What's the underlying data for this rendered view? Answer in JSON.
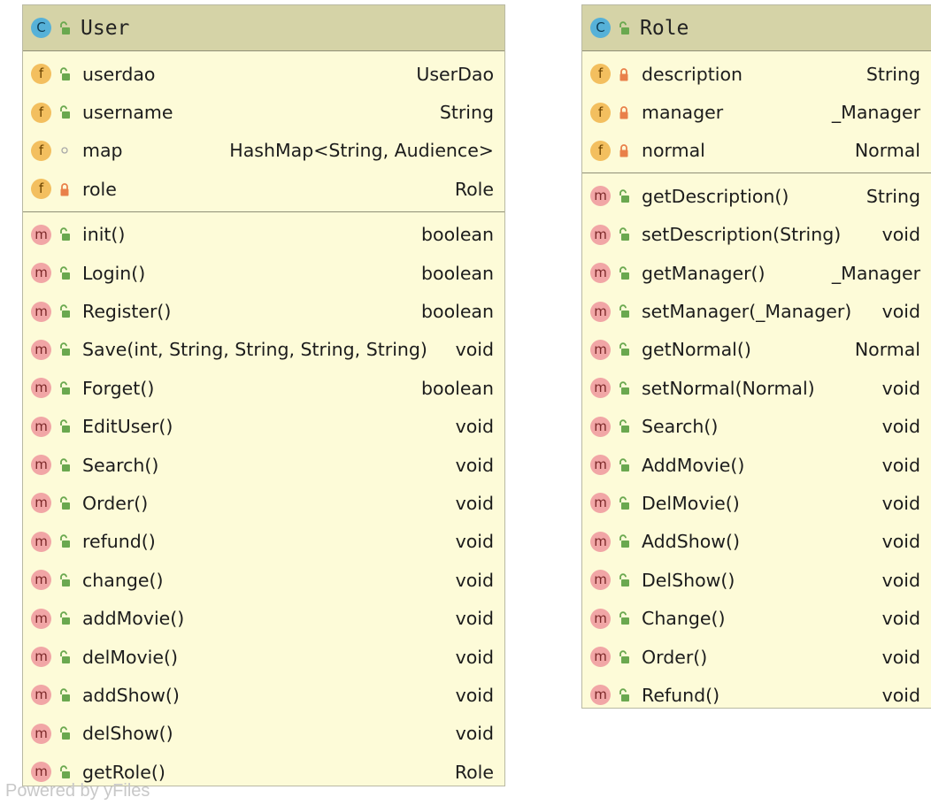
{
  "user_class": {
    "name": "User",
    "fields": [
      {
        "name": "userdao",
        "type": "UserDao",
        "vis": "public"
      },
      {
        "name": "username",
        "type": "String",
        "vis": "public"
      },
      {
        "name": "map",
        "type": "HashMap<String, Audience>",
        "vis": "package"
      },
      {
        "name": "role",
        "type": "Role",
        "vis": "private"
      }
    ],
    "methods": [
      {
        "name": "init()",
        "type": "boolean"
      },
      {
        "name": "Login()",
        "type": "boolean"
      },
      {
        "name": "Register()",
        "type": "boolean"
      },
      {
        "name": "Save(int, String, String, String, String)",
        "type": "void"
      },
      {
        "name": "Forget()",
        "type": "boolean"
      },
      {
        "name": "EditUser()",
        "type": "void"
      },
      {
        "name": "Search()",
        "type": "void"
      },
      {
        "name": "Order()",
        "type": "void"
      },
      {
        "name": "refund()",
        "type": "void"
      },
      {
        "name": "change()",
        "type": "void"
      },
      {
        "name": "addMovie()",
        "type": "void"
      },
      {
        "name": "delMovie()",
        "type": "void"
      },
      {
        "name": "addShow()",
        "type": "void"
      },
      {
        "name": "delShow()",
        "type": "void"
      },
      {
        "name": "getRole()",
        "type": "Role"
      }
    ]
  },
  "role_class": {
    "name": "Role",
    "fields": [
      {
        "name": "description",
        "type": "String",
        "vis": "private"
      },
      {
        "name": "manager",
        "type": "_Manager",
        "vis": "private"
      },
      {
        "name": "normal",
        "type": "Normal",
        "vis": "private"
      }
    ],
    "methods": [
      {
        "name": "getDescription()",
        "type": "String"
      },
      {
        "name": "setDescription(String)",
        "type": "void"
      },
      {
        "name": "getManager()",
        "type": "_Manager"
      },
      {
        "name": "setManager(_Manager)",
        "type": "void"
      },
      {
        "name": "getNormal()",
        "type": "Normal"
      },
      {
        "name": "setNormal(Normal)",
        "type": "void"
      },
      {
        "name": "Search()",
        "type": "void"
      },
      {
        "name": "AddMovie()",
        "type": "void"
      },
      {
        "name": "DelMovie()",
        "type": "void"
      },
      {
        "name": "AddShow()",
        "type": "void"
      },
      {
        "name": "DelShow()",
        "type": "void"
      },
      {
        "name": "Change()",
        "type": "void"
      },
      {
        "name": "Order()",
        "type": "void"
      },
      {
        "name": "Refund()",
        "type": "void"
      }
    ]
  },
  "icons": {
    "class_kind": "C",
    "field_kind": "f",
    "method_kind": "m",
    "public": "unlocked-padlock-icon",
    "private": "locked-padlock-icon",
    "package": "small-circle-icon"
  },
  "colors": {
    "class_fill": "#fdfbd8",
    "header_fill": "#d5d3a7",
    "class_icon": "#56b1d8",
    "field_icon": "#f3bf5f",
    "method_icon": "#f1a6a6",
    "public_icon": "#6aa84f",
    "private_icon": "#e9804a"
  },
  "watermark": "Powered by yFiles"
}
